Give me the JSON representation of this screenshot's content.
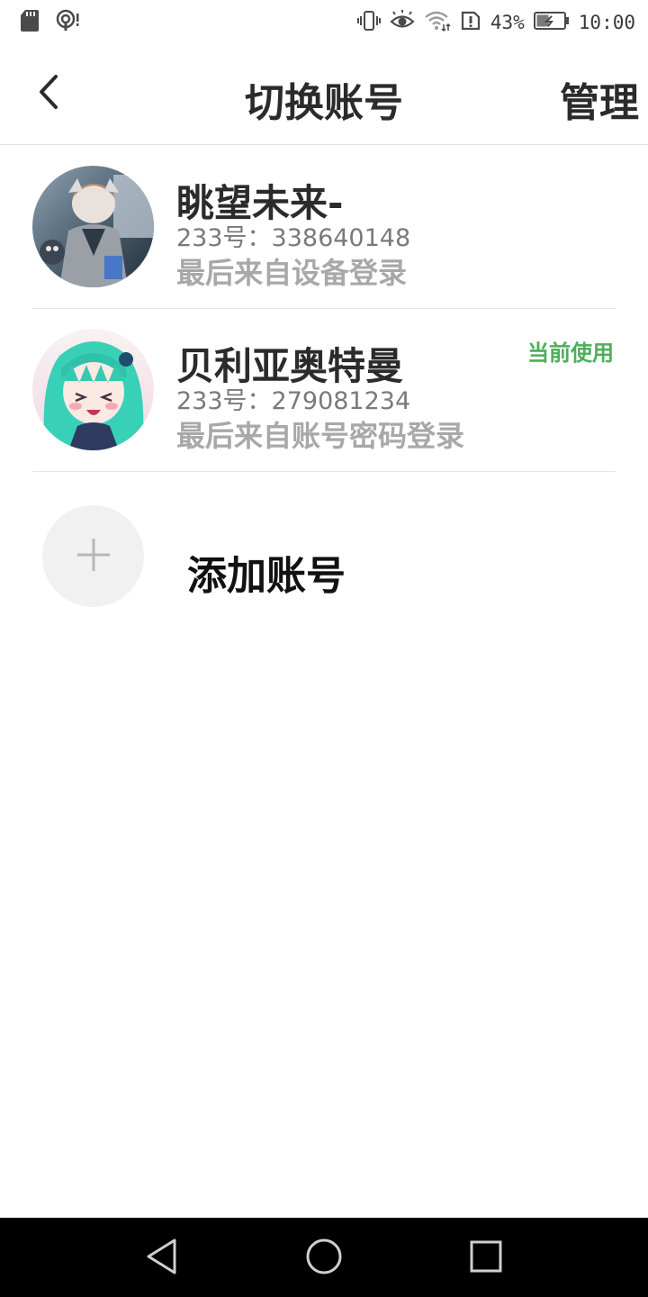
{
  "status_bar": {
    "battery_percent": "43%",
    "time": "10:00"
  },
  "header": {
    "title": "切换账号",
    "manage_label": "管理"
  },
  "accounts": [
    {
      "name": "眺望未来-",
      "id_text": "233号：338640148",
      "login_text": "最后来自设备登录",
      "is_current": false,
      "current_label": ""
    },
    {
      "name": "贝利亚奥特曼",
      "id_text": "233号：279081234",
      "login_text": "最后来自账号密码登录",
      "is_current": true,
      "current_label": "当前使用"
    }
  ],
  "add_account": {
    "label": "添加账号"
  },
  "colors": {
    "accent_green": "#4caf5a",
    "title_text": "#2b2b2b",
    "secondary_text": "#a8a8a8",
    "nav_bar": "#000000"
  },
  "icons": {
    "status_left": [
      "sd-card-icon",
      "hotspot-alert-icon"
    ],
    "status_right": [
      "vibrate-icon",
      "eye-comfort-icon",
      "wifi-icon",
      "alert-icon",
      "battery-charging-icon"
    ],
    "header": [
      "back-chevron-icon"
    ],
    "add": [
      "plus-icon"
    ],
    "nav": [
      "nav-back-icon",
      "nav-home-icon",
      "nav-recents-icon"
    ]
  }
}
